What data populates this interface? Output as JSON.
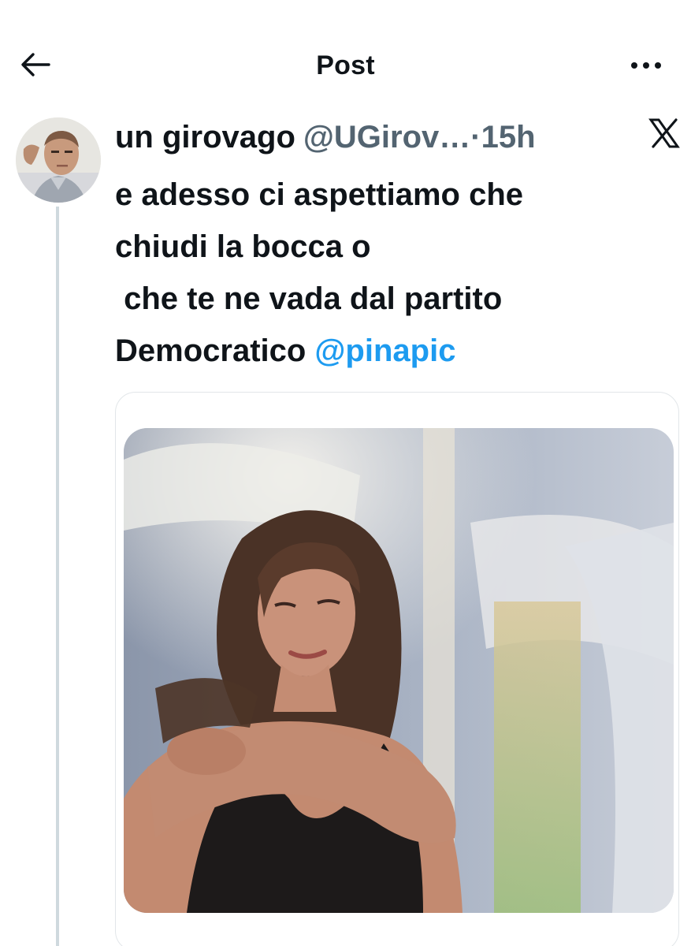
{
  "header": {
    "title": "Post",
    "back_icon": "arrow-left-icon",
    "more_icon": "more-horizontal-icon"
  },
  "tweet": {
    "author_name": "un girovago",
    "author_handle": "@UGirov…",
    "time_separator": "·",
    "time": "15h",
    "platform_icon": "x-logo-icon",
    "text_lines": [
      "e adesso ci aspettiamo che",
      "chiudi la bocca o",
      " che te ne vada dal partito"
    ],
    "text_last_line_prefix": "Democratico ",
    "mention": "@pinapic",
    "media_icon": "photo-image"
  },
  "colors": {
    "text": "#0f1419",
    "secondary": "#536471",
    "accent": "#1d9bf0",
    "thread_line": "#cfd9de",
    "card_border": "#e2e6e9"
  }
}
